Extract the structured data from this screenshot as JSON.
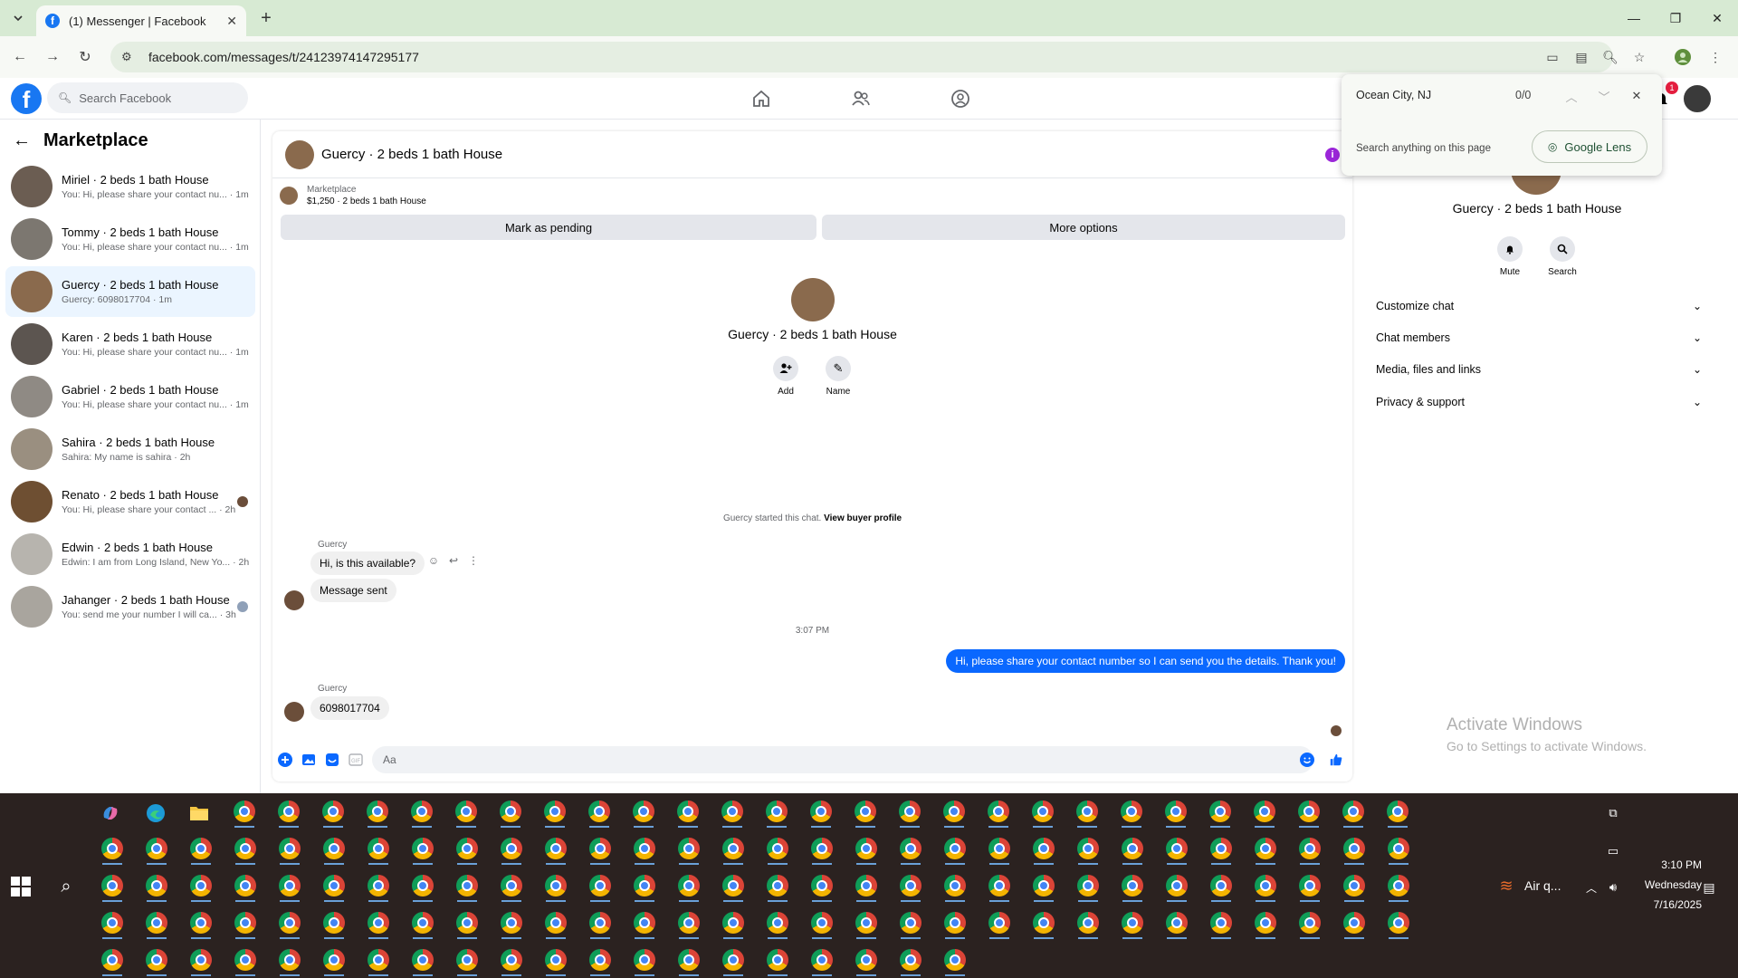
{
  "browser": {
    "tab_title": "(1) Messenger | Facebook",
    "url": "facebook.com/messages/t/24123974147295177"
  },
  "facebook": {
    "search_placeholder": "Search Facebook",
    "notification_count": "1"
  },
  "sidebar": {
    "title": "Marketplace",
    "conversations": [
      {
        "name": "Miriel · 2 beds 1 bath House",
        "preview": "You: Hi, please share your contact nu... · 1m",
        "color": "#6b5d52"
      },
      {
        "name": "Tommy · 2 beds 1 bath House",
        "preview": "You: Hi, please share your contact nu... · 1m",
        "color": "#7c7770"
      },
      {
        "name": "Guercy · 2 beds 1 bath House",
        "preview": "Guercy: 6098017704 · 1m",
        "color": "#8a6a4d",
        "active": true
      },
      {
        "name": "Karen · 2 beds 1 bath House",
        "preview": "You: Hi, please share your contact nu... · 1m",
        "color": "#5c5550"
      },
      {
        "name": "Gabriel · 2 beds 1 bath House",
        "preview": "You: Hi, please share your contact nu... · 1m",
        "color": "#8f8a84"
      },
      {
        "name": "Sahira · 2 beds 1 bath House",
        "preview": "Sahira: My name is sahira · 2h",
        "color": "#9a8f80"
      },
      {
        "name": "Renato · 2 beds 1 bath House",
        "preview": "You: Hi, please share your contact ... · 2h",
        "color": "#6e4f32"
      },
      {
        "name": "Edwin · 2 beds 1 bath House",
        "preview": "Edwin: I am from Long Island, New Yo... · 2h",
        "color": "#b7b4ae"
      },
      {
        "name": "Jahanger · 2 beds 1 bath House",
        "preview": "You: send me your number I will ca... · 3h",
        "color": "#a9a59e"
      }
    ]
  },
  "chat": {
    "title": "Guercy · 2 beds 1 bath House",
    "marketplace_label": "Marketplace",
    "listing": "$1,250 · 2 beds 1 bath House",
    "mark_pending": "Mark as pending",
    "more_options": "More options",
    "profile_name": "Guercy · 2 beds 1 bath House",
    "add_label": "Add",
    "name_label": "Name",
    "started_text": "Guercy started this chat.",
    "view_profile": "View buyer profile",
    "sender1": "Guercy",
    "msg1": "Hi, is this available?",
    "msg2": "Message sent",
    "time_sep": "3:07 PM",
    "msg_out": "Hi, please share your contact number so I can send you the details. Thank you!",
    "sender2": "Guercy",
    "msg3": "6098017704",
    "composer_placeholder": "Aa"
  },
  "details": {
    "name": "Guercy · 2 beds 1 bath House",
    "mute": "Mute",
    "search": "Search",
    "rows": [
      "Customize chat",
      "Chat members",
      "Media, files and links",
      "Privacy & support"
    ]
  },
  "findbar": {
    "query": "Ocean City, NJ",
    "count": "0/0",
    "hint": "Search anything on this page",
    "lens": "Google Lens"
  },
  "watermark": {
    "line1": "Activate Windows",
    "line2": "Go to Settings to activate Windows."
  },
  "taskbar": {
    "weather": "Air q...",
    "time": "3:10 PM",
    "day": "Wednesday",
    "date": "7/16/2025",
    "chrome_rows": [
      27,
      30,
      30,
      30,
      20
    ]
  },
  "colors": {
    "accent": "#1877f2",
    "bubble_out": "#0a68ff",
    "info": "#9b26d9"
  }
}
